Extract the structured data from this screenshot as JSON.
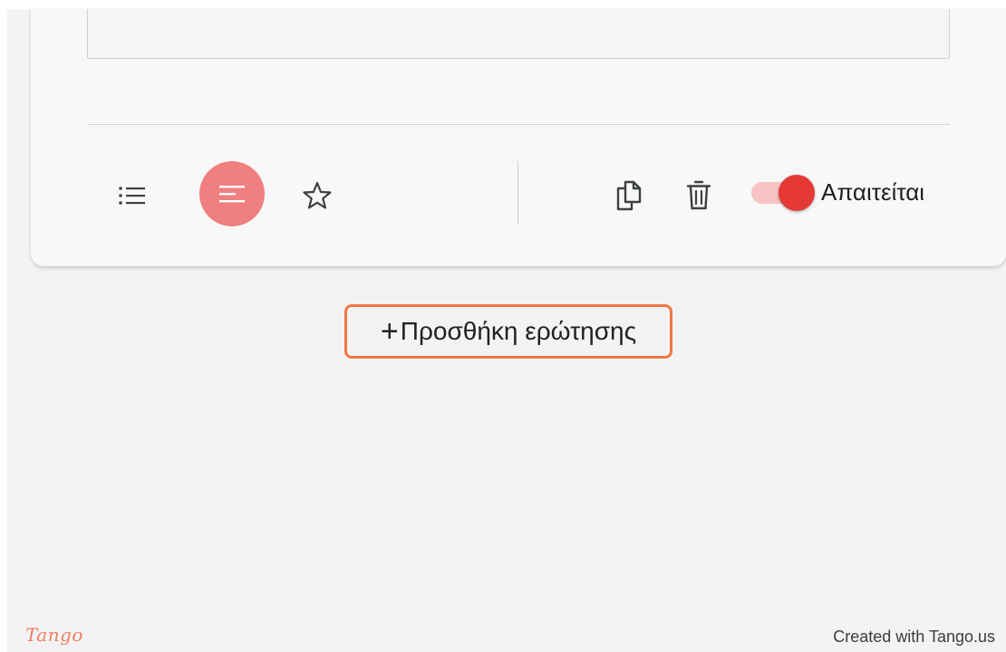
{
  "card": {
    "toolbar": {
      "list_icon": "list-bullets-icon",
      "paragraph_icon": "short-text-icon",
      "star_icon": "star-outline-icon",
      "duplicate_icon": "copy-icon",
      "delete_icon": "trash-icon"
    },
    "required": {
      "label": "Απαιτείται",
      "enabled": true
    }
  },
  "add_question": {
    "icon": "plus-icon",
    "plus_glyph": "+",
    "label": "Προσθήκη ερώτησης"
  },
  "footer": {
    "logo": "Tango",
    "created_with": "Created with Tango.us"
  },
  "colors": {
    "accent": "#f07f7f",
    "toggle_thumb": "#e53935",
    "toggle_track": "#f7c3c3",
    "highlight_border": "#f07842",
    "logo": "#f07f5c"
  }
}
